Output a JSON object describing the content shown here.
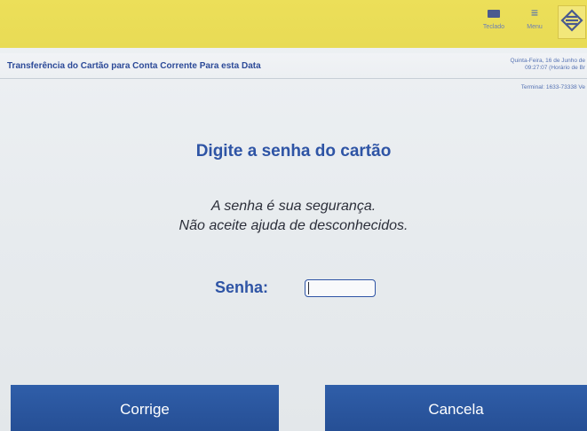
{
  "topbar": {
    "keyboard_label": "Teclado",
    "menu_label": "Menu",
    "menu_glyph": "≡"
  },
  "header": {
    "title": "Transferência do Cartão para Conta Corrente Para esta Data",
    "date_line1": "Quinta-Feira, 16 de Junho de",
    "date_line2": "09:27:07 (Horário de Br",
    "terminal": "Terminal: 1633-73338 Ve"
  },
  "main": {
    "title": "Digite a senha do cartão",
    "message_line1": "A senha é sua segurança.",
    "message_line2": "Não aceite ajuda de desconhecidos.",
    "password_label": "Senha:",
    "password_value": ""
  },
  "buttons": {
    "correct_label": "Corrige",
    "cancel_label": "Cancela"
  },
  "colors": {
    "topbar": "#e8db55",
    "accent_blue": "#2e54a5",
    "button_blue": "#2a57a0",
    "background": "#eceff2"
  }
}
